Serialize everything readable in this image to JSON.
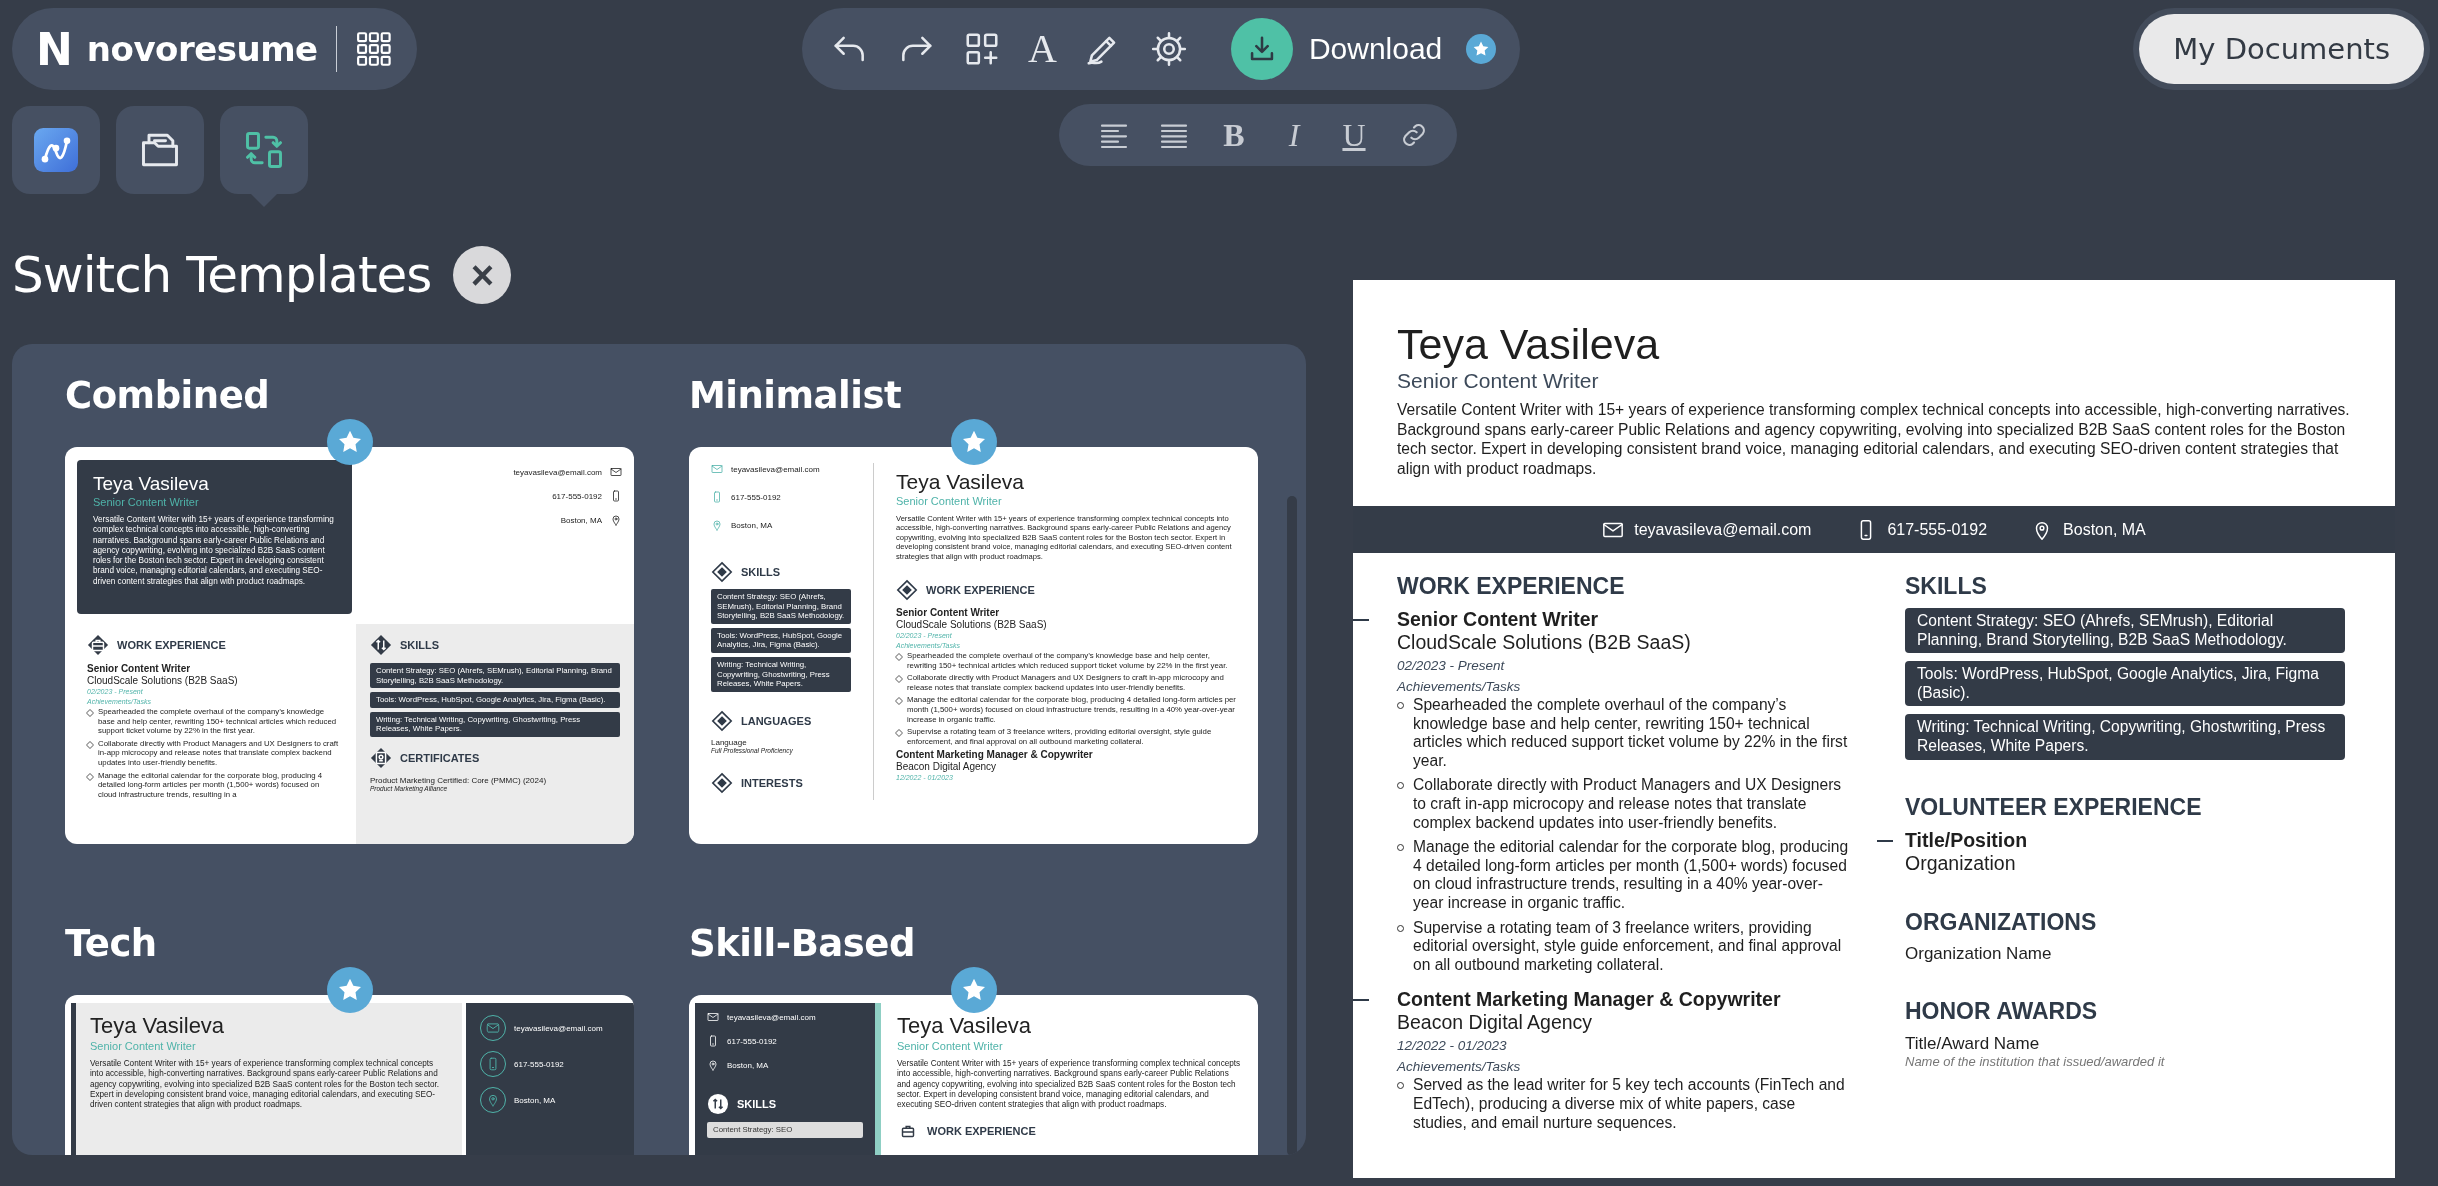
{
  "logo": {
    "mark": "N",
    "wordmark": "novoresume"
  },
  "toolbar": {
    "tools": [
      {
        "kind": "undo"
      },
      {
        "kind": "redo"
      },
      {
        "kind": "add_section"
      },
      {
        "kind": "font",
        "glyph": "A"
      },
      {
        "kind": "design"
      },
      {
        "kind": "settings"
      }
    ],
    "download": {
      "label": "Download"
    }
  },
  "format_bar": [
    {
      "kind": "align_left"
    },
    {
      "kind": "justify"
    },
    {
      "kind": "bold",
      "glyph": "B"
    },
    {
      "kind": "italic",
      "glyph": "I"
    },
    {
      "kind": "underline",
      "glyph": "U"
    },
    {
      "kind": "link"
    }
  ],
  "my_documents": {
    "label": "My Documents"
  },
  "side_tools": [
    {
      "kind": "ai",
      "selected": false
    },
    {
      "kind": "documents",
      "selected": false
    },
    {
      "kind": "templates",
      "selected": true
    }
  ],
  "switch_templates": {
    "title": "Switch Templates",
    "close": "×",
    "templates": [
      {
        "name": "Combined",
        "kind": "combined",
        "preview": {
          "name": "Teya Vasileva",
          "job_title": "Senior Content Writer",
          "summary": "Versatile Content Writer with 15+ years of experience transforming complex technical concepts into accessible, high-converting narratives. Background spans early-career Public Relations and agency copywriting, evolving into specialized B2B SaaS content roles for the Boston tech sector. Expert in developing consistent brand voice, managing editorial calendars, and executing SEO-driven content strategies that align with product roadmaps.",
          "contacts": [
            {
              "kind": "email",
              "text": "teyavasileva@email.com"
            },
            {
              "kind": "phone",
              "text": "617-555-0192"
            },
            {
              "kind": "location",
              "text": "Boston, MA"
            }
          ],
          "main": [
            {
              "kind": "experience",
              "heading": "WORK EXPERIENCE",
              "jobs": [
                {
                  "title": "Senior Content Writer",
                  "company": "CloudScale Solutions (B2B SaaS)",
                  "dates": "02/2023 - Present",
                  "label": "Achievements/Tasks",
                  "bullets": [
                    "Spearheaded the complete overhaul of the company’s knowledge base and help center, rewriting 150+ technical articles which reduced support ticket volume by 22% in the first year.",
                    "Collaborate directly with Product Managers and UX Designers to craft in-app microcopy and release notes that translate complex backend updates into user-friendly benefits.",
                    "Manage the editorial calendar for the corporate blog, producing 4 detailed long-form articles per month (1,500+ words) focused on cloud infrastructure trends, resulting in a"
                  ]
                }
              ]
            }
          ],
          "side": [
            {
              "kind": "skills",
              "heading": "SKILLS",
              "items": [
                "Content Strategy: SEO (Ahrefs, SEMrush), Editorial Planning, Brand Storytelling, B2B SaaS Methodology.",
                "Tools: WordPress, HubSpot, Google Analytics, Jira, Figma (Basic).",
                "Writing: Technical Writing, Copywriting, Ghostwriting, Press Releases, White Papers."
              ]
            },
            {
              "kind": "certificates",
              "heading": "CERTIFICATES",
              "items": [
                {
                  "name": "Product Marketing Certified: Core (PMMC) (2024)",
                  "issuer": "Product Marketing Alliance"
                }
              ]
            }
          ]
        }
      },
      {
        "name": "Minimalist",
        "kind": "minimalist",
        "preview": {
          "name": "Teya Vasileva",
          "job_title": "Senior Content Writer",
          "summary": "Versatile Content Writer with 15+ years of experience transforming complex technical concepts into accessible, high-converting narratives. Background spans early-career Public Relations and agency copywriting, evolving into specialized B2B SaaS content roles for the Boston tech sector. Expert in developing consistent brand voice, managing editorial calendars, and executing SEO-driven content strategies that align with product roadmaps.",
          "contacts": [
            {
              "kind": "email",
              "text": "teyavasileva@email.com"
            },
            {
              "kind": "phone",
              "text": "617-555-0192"
            },
            {
              "kind": "location",
              "text": "Boston, MA"
            }
          ],
          "main": [
            {
              "kind": "experience",
              "heading": "WORK EXPERIENCE",
              "jobs": [
                {
                  "title": "Senior Content Writer",
                  "company": "CloudScale Solutions (B2B SaaS)",
                  "dates": "02/2023 - Present",
                  "label": "Achievements/Tasks",
                  "bullets": [
                    "Spearheaded the complete overhaul of the company’s knowledge base and help center, rewriting 150+ technical articles which reduced support ticket volume by 22% in the first year.",
                    "Collaborate directly with Product Managers and UX Designers to craft in-app microcopy and release notes that translate complex backend updates into user-friendly benefits.",
                    "Manage the editorial calendar for the corporate blog, producing 4 detailed long-form articles per month (1,500+ words) focused on cloud infrastructure trends, resulting in a 40% year-over-year increase in organic traffic.",
                    "Supervise a rotating team of 3 freelance writers, providing editorial oversight, style guide enforcement, and final approval on all outbound marketing collateral."
                  ]
                },
                {
                  "title": "Content Marketing Manager & Copywriter",
                  "company": "Beacon Digital Agency",
                  "dates": "12/2022 - 01/2023"
                }
              ]
            }
          ],
          "side": [
            {
              "kind": "skills",
              "heading": "SKILLS",
              "items": [
                "Content Strategy: SEO (Ahrefs, SEMrush), Editorial Planning, Brand Storytelling, B2B SaaS Methodology.",
                "Tools: WordPress, HubSpot, Google Analytics, Jira, Figma (Basic).",
                "Writing: Technical Writing, Copywriting, Ghostwriting, Press Releases, White Papers."
              ]
            },
            {
              "kind": "languages",
              "heading": "LANGUAGES",
              "items": [
                {
                  "name": "Language",
                  "level": "Full Professional Proficiency"
                }
              ]
            },
            {
              "kind": "heading_only",
              "heading": "INTERESTS"
            }
          ]
        }
      },
      {
        "name": "Tech",
        "kind": "tech",
        "preview": {
          "name": "Teya Vasileva",
          "job_title": "Senior Content Writer",
          "summary": "Versatile Content Writer with 15+ years of experience transforming complex technical concepts into accessible, high-converting narratives. Background spans early-career Public Relations and agency copywriting, evolving into specialized B2B SaaS content roles for the Boston tech sector. Expert in developing consistent brand voice, managing editorial calendars, and executing SEO-driven content strategies that align with product roadmaps.",
          "contacts": [
            {
              "kind": "email",
              "text": "teyavasileva@email.com"
            },
            {
              "kind": "phone",
              "text": "617-555-0192"
            },
            {
              "kind": "location",
              "text": "Boston, MA"
            }
          ]
        }
      },
      {
        "name": "Skill-Based",
        "kind": "skill_based",
        "preview": {
          "name": "Teya Vasileva",
          "job_title": "Senior Content Writer",
          "summary": "Versatile Content Writer with 15+ years of experience transforming complex technical concepts into accessible, high-converting narratives. Background spans early-career Public Relations and agency copywriting, evolving into specialized B2B SaaS content roles for the Boston tech sector. Expert in developing consistent brand voice, managing editorial calendars, and executing SEO-driven content strategies that align with product roadmaps.",
          "contacts": [
            {
              "kind": "email",
              "text": "teyavasileva@email.com"
            },
            {
              "kind": "phone",
              "text": "617-555-0192"
            },
            {
              "kind": "location",
              "text": "Boston, MA"
            }
          ],
          "main": [
            {
              "kind": "experience",
              "heading": "WORK EXPERIENCE"
            }
          ],
          "side": [
            {
              "kind": "skills",
              "heading": "SKILLS",
              "items": [
                "Content Strategy: SEO"
              ]
            }
          ]
        }
      }
    ]
  },
  "resume": {
    "name": "Teya Vasileva",
    "job_title": "Senior Content Writer",
    "summary": "Versatile Content Writer with 15+ years of experience transforming complex technical concepts into accessible, high-converting narratives. Background spans early-career Public Relations and agency copywriting, evolving into specialized B2B SaaS content roles for the Boston tech sector. Expert in developing consistent brand voice, managing editorial calendars, and executing SEO-driven content strategies that align with product roadmaps.",
    "contacts": [
      {
        "kind": "email",
        "text": "teyavasileva@email.com"
      },
      {
        "kind": "phone",
        "text": "617-555-0192"
      },
      {
        "kind": "location",
        "text": "Boston, MA"
      }
    ],
    "main": [
      {
        "kind": "experience",
        "heading": "WORK EXPERIENCE",
        "jobs": [
          {
            "title": "Senior Content Writer",
            "company": "CloudScale Solutions (B2B SaaS)",
            "dates": "02/2023 - Present",
            "label": "Achievements/Tasks",
            "bullets": [
              "Spearheaded the complete overhaul of the company’s knowledge base and help center, rewriting 150+ technical articles which reduced support ticket volume by 22% in the first year.",
              "Collaborate directly with Product Managers and UX Designers to craft in-app microcopy and release notes that translate complex backend updates into user-friendly benefits.",
              "Manage the editorial calendar for the corporate blog, producing 4 detailed long-form articles per month (1,500+ words) focused on cloud infrastructure trends, resulting in a 40% year-over-year increase in organic traffic.",
              "Supervise a rotating team of 3 freelance writers, providing editorial oversight, style guide enforcement, and final approval on all outbound marketing collateral."
            ]
          },
          {
            "title": "Content Marketing Manager & Copywriter",
            "company": "Beacon Digital Agency",
            "dates": "12/2022 - 01/2023",
            "label": "Achievements/Tasks",
            "bullets": [
              "Served as the lead writer for 5 key tech accounts (FinTech and EdTech), producing a diverse mix of white papers, case studies, and email nurture sequences."
            ]
          }
        ]
      }
    ],
    "side": [
      {
        "kind": "skills",
        "heading": "SKILLS",
        "items": [
          "Content Strategy: SEO (Ahrefs, SEMrush), Editorial Planning, Brand Storytelling, B2B SaaS Methodology.",
          "Tools: WordPress, HubSpot, Google Analytics, Jira, Figma (Basic).",
          "Writing: Technical Writing, Copywriting, Ghostwriting, Press Releases, White Papers."
        ]
      },
      {
        "kind": "volunteer",
        "heading": "VOLUNTEER EXPERIENCE",
        "items": [
          {
            "title": "Title/Position",
            "organization": "Organization"
          }
        ]
      },
      {
        "kind": "list",
        "heading": "ORGANIZATIONS",
        "items": [
          "Organization Name"
        ]
      },
      {
        "kind": "certificates",
        "heading": "HONOR AWARDS",
        "items": [
          {
            "name": "Title/Award Name",
            "issuer": "Name of the institution that issued/awarded it"
          }
        ]
      }
    ]
  }
}
